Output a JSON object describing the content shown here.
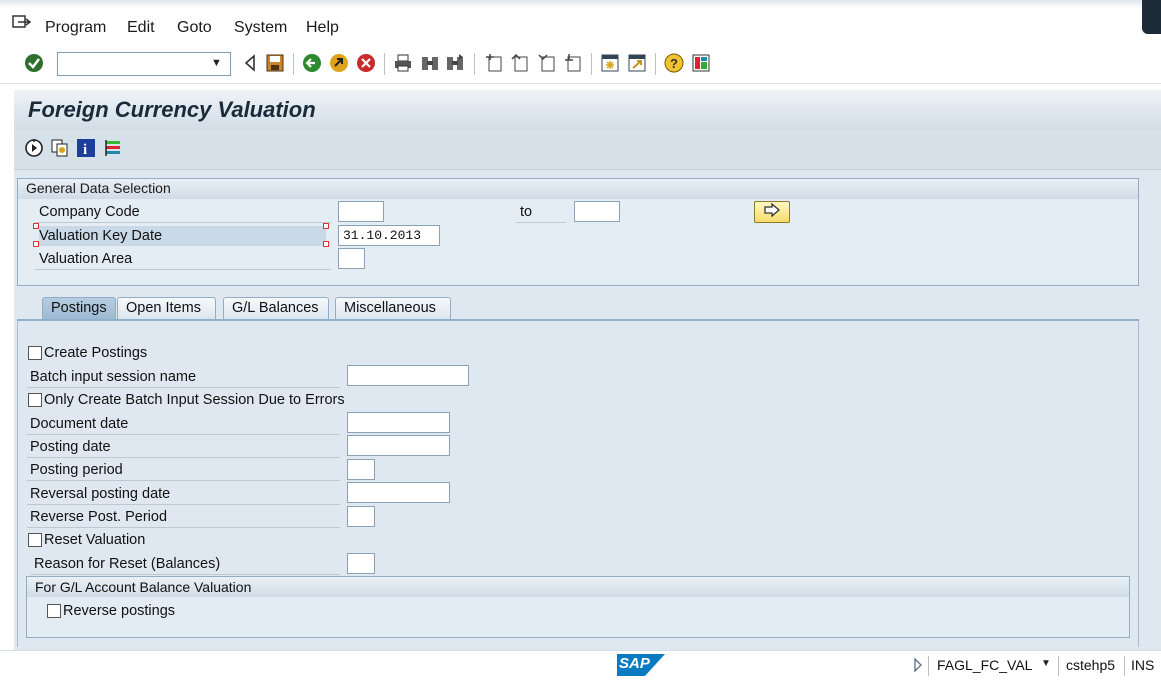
{
  "menu": {
    "items": [
      {
        "label": "Program"
      },
      {
        "label": "Edit"
      },
      {
        "label": "Goto"
      },
      {
        "label": "System"
      },
      {
        "label": "Help"
      }
    ]
  },
  "toolbar": {
    "command_field_value": ""
  },
  "screen": {
    "title": "Foreign Currency Valuation"
  },
  "general": {
    "title": "General Data Selection",
    "company_code_label": "Company Code",
    "company_code_from": "",
    "to_label": "to",
    "company_code_to": "",
    "valuation_key_date_label": "Valuation Key Date",
    "valuation_key_date": "31.10.2013",
    "valuation_area_label": "Valuation Area",
    "valuation_area": ""
  },
  "tabs": [
    {
      "label": "Postings",
      "active": true
    },
    {
      "label": "Open Items",
      "active": false
    },
    {
      "label": "G/L Balances",
      "active": false
    },
    {
      "label": "Miscellaneous",
      "active": false
    }
  ],
  "postings": {
    "create_postings_label": "Create Postings",
    "create_postings_checked": false,
    "batch_session_label": "Batch input session name",
    "batch_session_value": "",
    "only_batch_errors_label": "Only Create Batch Input Session Due to Errors",
    "only_batch_errors_checked": false,
    "document_date_label": "Document date",
    "document_date": "",
    "posting_date_label": "Posting date",
    "posting_date": "",
    "posting_period_label": "Posting period",
    "posting_period": "",
    "reversal_posting_date_label": "Reversal posting date",
    "reversal_posting_date": "",
    "reverse_post_period_label": "Reverse Post. Period",
    "reverse_post_period": "",
    "reset_valuation_label": "Reset Valuation",
    "reset_valuation_checked": false,
    "reason_reset_label": "Reason for Reset (Balances)",
    "reason_reset": "",
    "gl_group_title": "For G/L Account Balance Valuation",
    "reverse_postings_label": "Reverse postings",
    "reverse_postings_checked": false
  },
  "status": {
    "logo": "SAP",
    "transaction": "FAGL_FC_VAL",
    "server": "cstehp5",
    "mode": "INS"
  },
  "colors": {
    "accent_blue": "#9dbad3",
    "panel_bg": "#dfe8f0",
    "sap_logo": "#0b7bc1"
  }
}
